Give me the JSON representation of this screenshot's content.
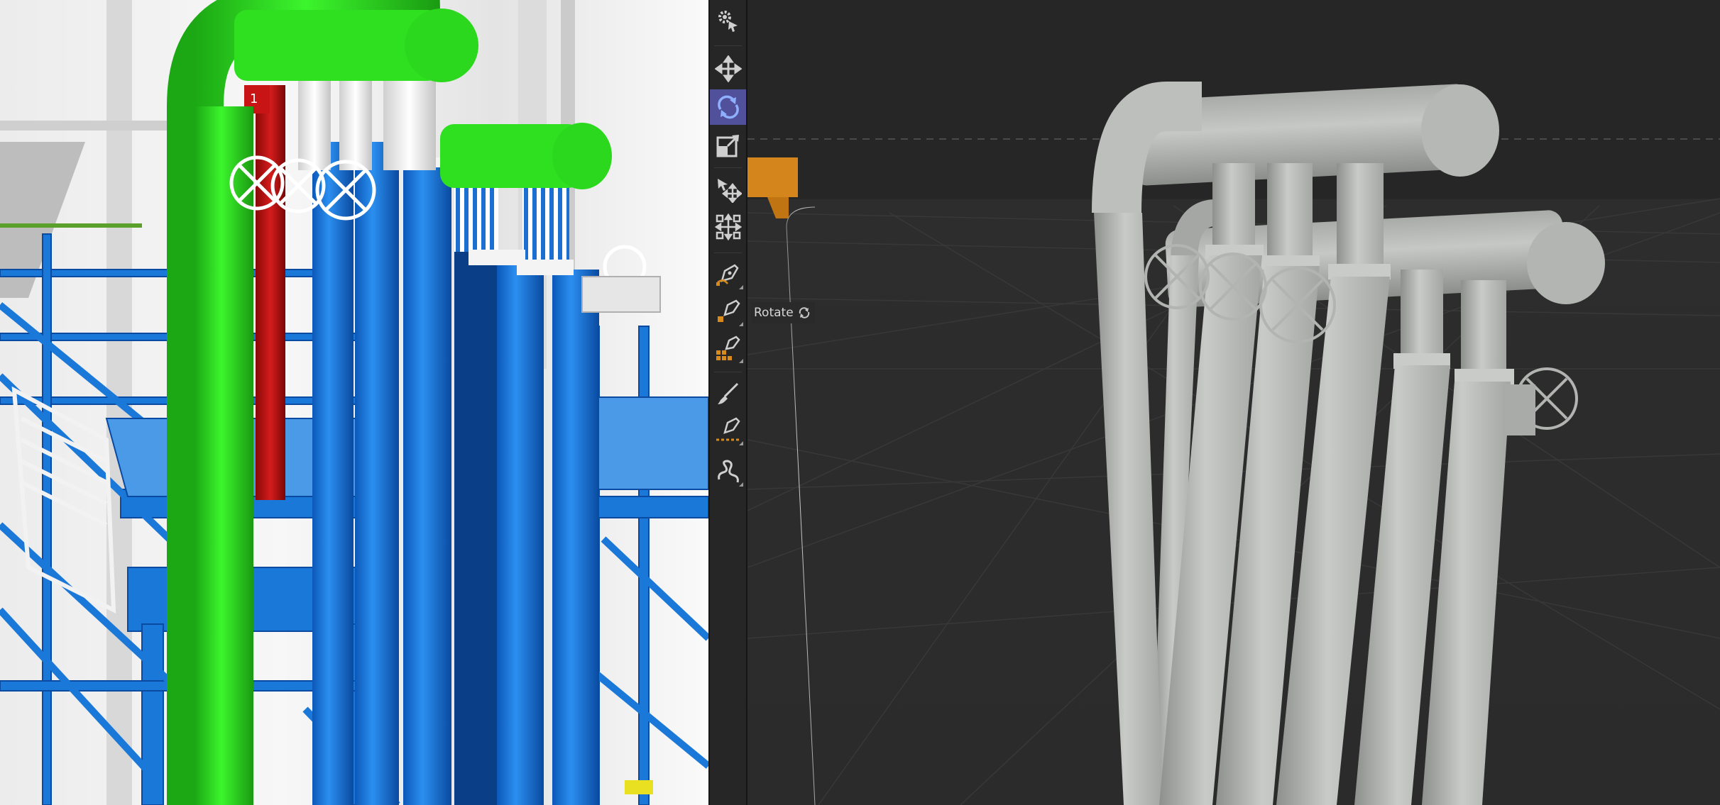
{
  "toolbar": {
    "tools": [
      {
        "name": "settings-pointer-tool",
        "active": false
      },
      {
        "name": "move-tool",
        "active": false
      },
      {
        "name": "rotate-tool",
        "active": true
      },
      {
        "name": "scale-tool",
        "active": false
      },
      {
        "name": "select-move-tool",
        "active": false
      },
      {
        "name": "transform-tool",
        "active": false
      },
      {
        "name": "pen-tool",
        "active": false
      },
      {
        "name": "pen-point-tool",
        "active": false
      },
      {
        "name": "pen-cluster-tool",
        "active": false
      },
      {
        "name": "brush-tool",
        "active": false
      },
      {
        "name": "pen-line-tool",
        "active": false
      },
      {
        "name": "spline-tool",
        "active": false
      }
    ]
  },
  "viewport": {
    "tooltip_label": "Rotate",
    "object_color": "#bdbfbc",
    "grid_color": "#3a3a3a"
  },
  "reference": {
    "tag_label": "1",
    "colors": {
      "green": "#2ee020",
      "blue": "#1a78d8",
      "red": "#c81414",
      "white": "#ffffff"
    }
  }
}
